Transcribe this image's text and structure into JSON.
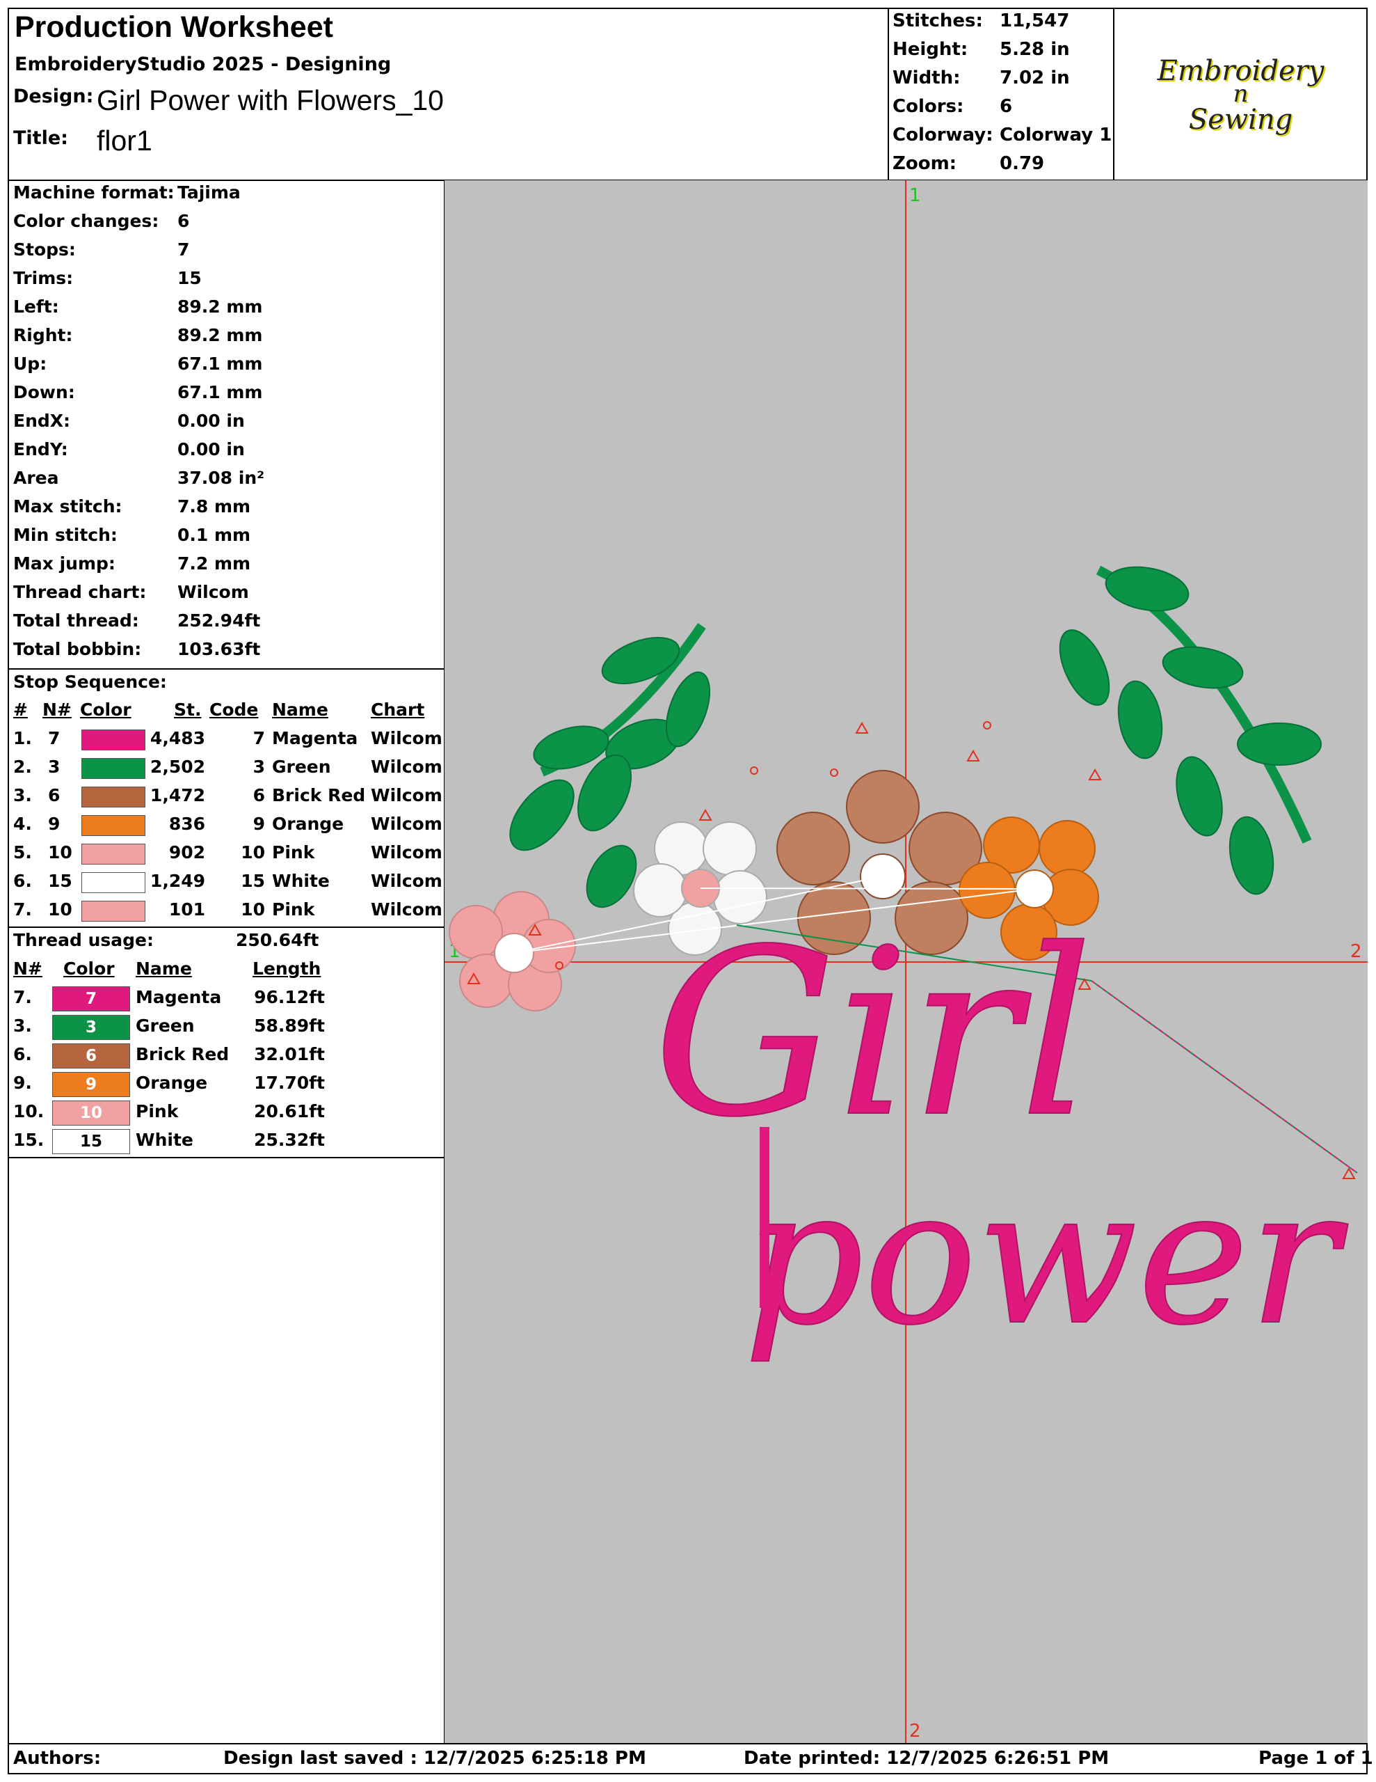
{
  "header": {
    "title": "Production Worksheet",
    "software": "EmbroideryStudio 2025 - Designing",
    "design_label": "Design:",
    "design_value": "Girl Power with Flowers_10",
    "title_label": "Title:",
    "title_value": "flor1"
  },
  "stats": [
    {
      "label": "Stitches:",
      "value": "11,547"
    },
    {
      "label": "Height:",
      "value": "5.28 in"
    },
    {
      "label": "Width:",
      "value": "7.02 in"
    },
    {
      "label": "Colors:",
      "value": "6"
    },
    {
      "label": "Colorway:",
      "value": "Colorway 1"
    },
    {
      "label": "Zoom:",
      "value": "0.79"
    }
  ],
  "logo": {
    "line1": "Embroidery",
    "line2": "n",
    "line3": "Sewing"
  },
  "machine_info": [
    {
      "label": "Machine format:",
      "value": "Tajima"
    },
    {
      "label": "Color changes:",
      "value": "6"
    },
    {
      "label": "Stops:",
      "value": "7"
    },
    {
      "label": "Trims:",
      "value": "15"
    },
    {
      "label": "Left:",
      "value": "89.2 mm"
    },
    {
      "label": "Right:",
      "value": "89.2 mm"
    },
    {
      "label": "Up:",
      "value": "67.1 mm"
    },
    {
      "label": "Down:",
      "value": "67.1 mm"
    },
    {
      "label": "EndX:",
      "value": "0.00 in"
    },
    {
      "label": "EndY:",
      "value": "0.00 in"
    },
    {
      "label": "Area",
      "value": " 37.08 in²"
    },
    {
      "label": "Max stitch:",
      "value": "7.8 mm"
    },
    {
      "label": "Min stitch:",
      "value": "0.1 mm"
    },
    {
      "label": "Max jump:",
      "value": "7.2 mm"
    },
    {
      "label": "Thread chart:",
      "value": "Wilcom"
    },
    {
      "label": "Total thread:",
      "value": "252.94ft"
    },
    {
      "label": "Total bobbin:",
      "value": "103.63ft"
    }
  ],
  "stop_sequence": {
    "title": "Stop Sequence:",
    "headers": {
      "num": "#",
      "n": "N#",
      "color": "Color",
      "st": "St.",
      "code": "Code",
      "name": "Name",
      "chart": "Chart"
    },
    "rows": [
      {
        "num": "1.",
        "n": "7",
        "color": "#e0197f",
        "st": "4,483",
        "code": "7",
        "name": "Magenta",
        "chart": "Wilcom"
      },
      {
        "num": "2.",
        "n": "3",
        "color": "#0b9447",
        "st": "2,502",
        "code": "3",
        "name": "Green",
        "chart": "Wilcom"
      },
      {
        "num": "3.",
        "n": "6",
        "color": "#b5663f",
        "st": "1,472",
        "code": "6",
        "name": "Brick Red",
        "chart": "Wilcom"
      },
      {
        "num": "4.",
        "n": "9",
        "color": "#ec7c1e",
        "st": "836",
        "code": "9",
        "name": "Orange",
        "chart": "Wilcom"
      },
      {
        "num": "5.",
        "n": "10",
        "color": "#f2a1a2",
        "st": "902",
        "code": "10",
        "name": "Pink",
        "chart": "Wilcom"
      },
      {
        "num": "6.",
        "n": "15",
        "color": "#ffffff",
        "st": "1,249",
        "code": "15",
        "name": "White",
        "chart": "Wilcom"
      },
      {
        "num": "7.",
        "n": "10",
        "color": "#f2a1a2",
        "st": "101",
        "code": "10",
        "name": "Pink",
        "chart": "Wilcom"
      }
    ]
  },
  "thread_usage": {
    "title": "Thread usage:",
    "total": "250.64ft",
    "headers": {
      "n": "N#",
      "color": "Color",
      "name": "Name",
      "length": "Length"
    },
    "rows": [
      {
        "n": "7.",
        "code": "7",
        "color": "#e0197f",
        "name": "Magenta",
        "length": "96.12ft",
        "text": "#ffffff"
      },
      {
        "n": "3.",
        "code": "3",
        "color": "#0b9447",
        "name": "Green",
        "length": "58.89ft",
        "text": "#ffffff"
      },
      {
        "n": "6.",
        "code": "6",
        "color": "#b5663f",
        "name": "Brick Red",
        "length": "32.01ft",
        "text": "#ffffff"
      },
      {
        "n": "9.",
        "code": "9",
        "color": "#ec7c1e",
        "name": "Orange",
        "length": "17.70ft",
        "text": "#ffffff"
      },
      {
        "n": "10.",
        "code": "10",
        "color": "#f2a1a2",
        "name": "Pink",
        "length": "20.61ft",
        "text": "#ffffff"
      },
      {
        "n": "15.",
        "code": "15",
        "color": "#ffffff",
        "name": "White",
        "length": "25.32ft",
        "text": "#000000"
      }
    ]
  },
  "preview": {
    "background": "#c0c0c0",
    "axis_color": "#e0301e",
    "marker_color": "#1fc21f",
    "markers": {
      "top": "1",
      "bottom": "2",
      "left": "1",
      "right": "2"
    },
    "design_text_line1": "Girl",
    "design_text_line2": "power"
  },
  "footer": {
    "authors": "Authors:",
    "saved": "Design last saved : 12/7/2025 6:25:18 PM",
    "printed": "Date printed: 12/7/2025 6:26:51 PM",
    "page": "Page 1 of 1"
  }
}
